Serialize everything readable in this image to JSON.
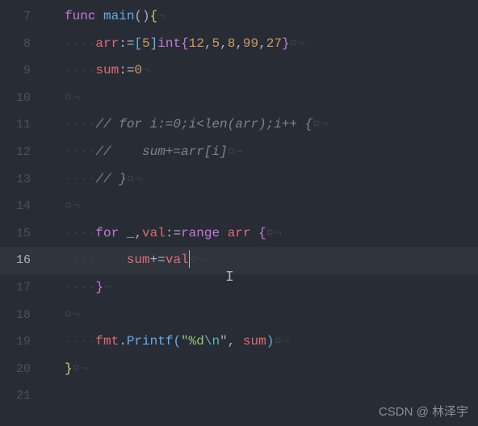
{
  "lines": [
    {
      "num": "7",
      "html": "<span class='keyword'>func</span> <span class='funcname'>main</span><span class='paren'>()</span><span class='brace'>{</span><span class='ws'>¬</span>"
    },
    {
      "num": "8",
      "html": "<span class='ws'>····</span><span class='ident'>arr</span><span class='operator'>:=</span><span class='bracket'>[</span><span class='number'>5</span><span class='bracket'>]</span><span class='type'>int</span><span class='brace2'>{</span><span class='number'>12</span><span class='plain'>,</span><span class='number'>5</span><span class='plain'>,</span><span class='number'>8</span><span class='plain'>,</span><span class='number'>99</span><span class='plain'>,</span><span class='number'>27</span><span class='brace2'>}</span><span class='ws'>¤¬</span>"
    },
    {
      "num": "9",
      "html": "<span class='ws'>····</span><span class='ident'>sum</span><span class='operator'>:=</span><span class='number'>0</span><span class='ws'>¬</span>"
    },
    {
      "num": "10",
      "html": "<span class='ws'>¤¬</span>"
    },
    {
      "num": "11",
      "html": "<span class='ws'>····</span><span class='comment'>// for i:=0;i&lt;len(arr);i++ {</span><span class='ws'>¤¬</span>"
    },
    {
      "num": "12",
      "html": "<span class='ws'>····</span><span class='comment'>//    sum+=arr[i]</span><span class='ws'>¤¬</span>"
    },
    {
      "num": "13",
      "html": "<span class='ws'>····</span><span class='comment'>// }</span><span class='ws'>¤¬</span>"
    },
    {
      "num": "14",
      "html": "<span class='ws'>¤¬</span>"
    },
    {
      "num": "15",
      "html": "<span class='ws'>····</span><span class='keyword'>for</span> <span class='underscore'>_</span><span class='plain'>,</span><span class='ident'>val</span><span class='operator'>:=</span><span class='keyword'>range</span> <span class='ident'>arr</span> <span class='brace2'>{</span><span class='ws'>¤¬</span>"
    },
    {
      "num": "16",
      "html": "<span class='ws'>····</span><span class='indent-guide'>·</span><span class='ws'>···</span><span class='ident'>sum</span><span class='operator'>+=</span><span class='ident'>val</span><span class='cursor'></span><span class='ws'>¤¬</span>",
      "current": true
    },
    {
      "num": "17",
      "html": "<span class='ws'>····</span><span class='brace2'>}</span><span class='ws'>¬</span>"
    },
    {
      "num": "18",
      "html": "<span class='ws'>¤¬</span>"
    },
    {
      "num": "19",
      "html": "<span class='ws'>····</span><span class='ident'>fmt</span><span class='plain'>.</span><span class='member'>Printf</span><span class='bracket'>(</span><span class='string'>\"%d</span><span class='escape'>\\n</span><span class='string'>\"</span><span class='plain'>, </span><span class='ident'>sum</span><span class='bracket'>)</span><span class='ws'>¤¬</span>"
    },
    {
      "num": "20",
      "html": "<span class='brace'>}</span><span class='ws'>¤¬</span>"
    },
    {
      "num": "21",
      "html": ""
    }
  ],
  "watermark": "CSDN @ 林泽宇"
}
